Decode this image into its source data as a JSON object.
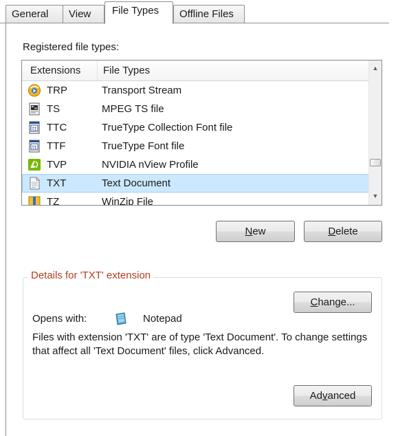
{
  "tabs": [
    {
      "label": "General",
      "active": false
    },
    {
      "label": "View",
      "active": false
    },
    {
      "label": "File Types",
      "active": true
    },
    {
      "label": "Offline Files",
      "active": false
    }
  ],
  "registered_label": "Registered file types:",
  "list": {
    "columns": {
      "extensions": "Extensions",
      "file_types": "File Types"
    },
    "rows": [
      {
        "ext": "TRP",
        "type": "Transport Stream",
        "icon": "media-player-icon"
      },
      {
        "ext": "TS",
        "type": "MPEG TS file",
        "icon": "mpeg-file-icon"
      },
      {
        "ext": "TTC",
        "type": "TrueType Collection Font file",
        "icon": "font-file-icon"
      },
      {
        "ext": "TTF",
        "type": "TrueType Font file",
        "icon": "font-file-icon"
      },
      {
        "ext": "TVP",
        "type": "NVIDIA nView Profile",
        "icon": "nvidia-icon"
      },
      {
        "ext": "TXT",
        "type": "Text Document",
        "icon": "text-document-icon",
        "selected": true
      },
      {
        "ext": "TZ",
        "type": "WinZip File",
        "icon": "winzip-icon"
      }
    ]
  },
  "buttons": {
    "new": {
      "mnemonic": "N",
      "rest": "ew"
    },
    "delete": {
      "mnemonic": "D",
      "rest": "elete"
    },
    "change": {
      "mnemonic": "C",
      "rest": "hange..."
    },
    "advanced": {
      "before": "Ad",
      "mnemonic": "v",
      "rest": "anced"
    }
  },
  "details": {
    "title": "Details for 'TXT' extension",
    "opens_with_label": "Opens with:",
    "app_name": "Notepad",
    "description": "Files with extension 'TXT' are of type 'Text Document'.  To change settings that affect all 'Text Document' files, click Advanced."
  },
  "colors": {
    "selection": "#cce8ff",
    "group_title": "#b53c1e"
  }
}
